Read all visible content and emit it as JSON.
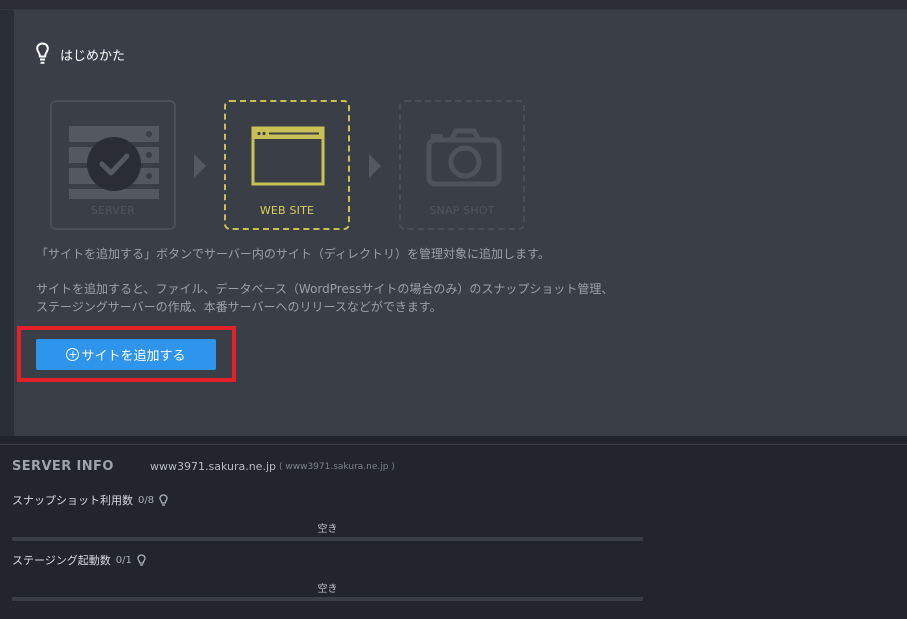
{
  "guide": {
    "title": "はじめかた",
    "steps": [
      {
        "label": "SERVER",
        "state": "done",
        "icon": "server-icon"
      },
      {
        "label": "WEB SITE",
        "state": "active",
        "icon": "browser-window-icon"
      },
      {
        "label": "SNAP SHOT",
        "state": "todo",
        "icon": "camera-icon"
      }
    ],
    "description_1": "「サイトを追加する」ボタンでサーバー内のサイト（ディレクトリ）を管理対象に追加します。",
    "description_2_line1": "サイトを追加すると、ファイル、データベース（WordPressサイトの場合のみ）のスナップショット管理、",
    "description_2_line2": "ステージングサーバーの作成、本番サーバーへのリリースなどができます。",
    "add_site_button": "サイトを追加する",
    "colors": {
      "accent": "#2f95ec",
      "active_step": "#d8cf5a",
      "highlight": "#e4202b"
    }
  },
  "server_info": {
    "title": "SERVER INFO",
    "host": "www3971.sakura.ne.jp",
    "host_paren": "( www3971.sakura.ne.jp )",
    "meters": [
      {
        "label": "スナップショット利用数",
        "count": "0/8",
        "status": "空き",
        "used": 0,
        "total": 8
      },
      {
        "label": "ステージング起動数",
        "count": "0/1",
        "status": "空き",
        "used": 0,
        "total": 1
      }
    ]
  }
}
